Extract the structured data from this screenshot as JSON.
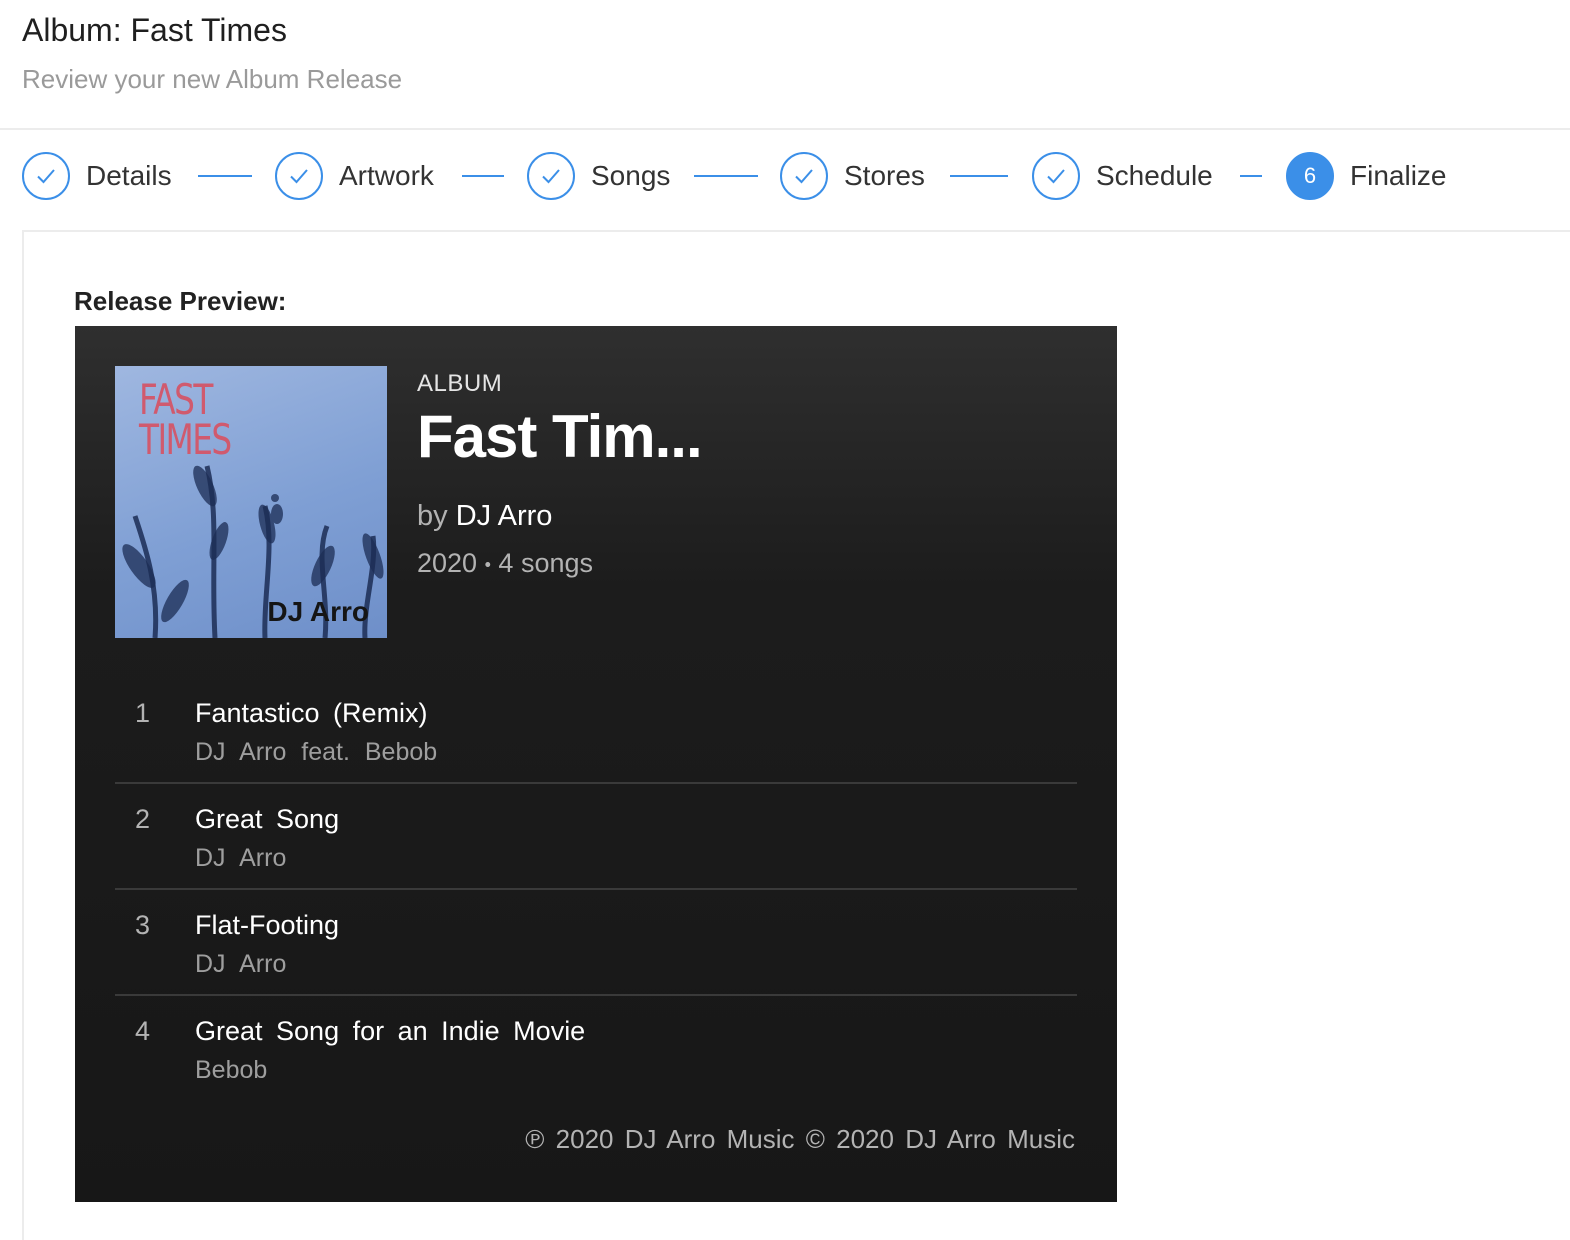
{
  "header": {
    "title": "Album: Fast Times",
    "subtitle": "Review your new Album Release"
  },
  "steps": [
    {
      "label": "Details",
      "state": "done"
    },
    {
      "label": "Artwork",
      "state": "done"
    },
    {
      "label": "Songs",
      "state": "done"
    },
    {
      "label": "Stores",
      "state": "done"
    },
    {
      "label": "Schedule",
      "state": "done"
    },
    {
      "label": "Finalize",
      "state": "active",
      "number": "6"
    }
  ],
  "preview": {
    "label": "Release Preview:",
    "cover": {
      "title_line1": "FAST",
      "title_line2": "TIMES",
      "artist": "DJ Arro"
    },
    "type": "ALBUM",
    "title": "Fast Tim...",
    "by_prefix": "by",
    "artist": "DJ Arro",
    "year": "2020",
    "separator": "•",
    "song_count": "4 songs",
    "tracks": [
      {
        "num": "1",
        "title": "Fantastico (Remix)",
        "artist": "DJ Arro feat. Bebob"
      },
      {
        "num": "2",
        "title": "Great Song",
        "artist": "DJ Arro"
      },
      {
        "num": "3",
        "title": "Flat-Footing",
        "artist": "DJ Arro"
      },
      {
        "num": "4",
        "title": "Great Song for an Indie Movie",
        "artist": "Bebob"
      }
    ],
    "copyright": "℗ 2020 DJ Arro Music © 2020 DJ Arro Music"
  },
  "colors": {
    "accent": "#3b8fe8",
    "player_bg": "#171717"
  }
}
